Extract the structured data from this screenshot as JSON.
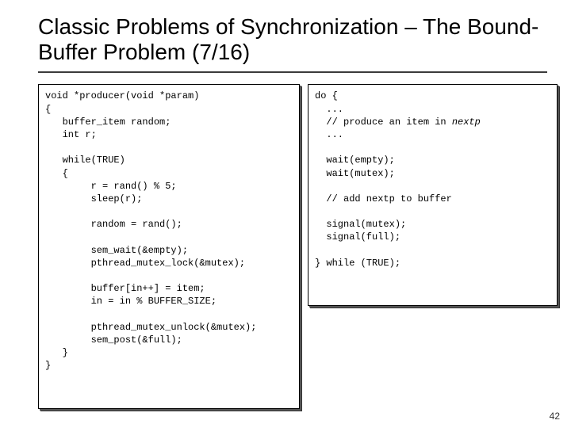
{
  "title": "Classic Problems of Synchronization – The Bound-Buffer Problem (7/16)",
  "left": {
    "l01": "void *producer(void *param)",
    "l02": "{",
    "l03": "   buffer_item random;",
    "l04": "   int r;",
    "l05": "",
    "l06": "   while(TRUE)",
    "l07": "   {",
    "l08": "        r = rand() % 5;",
    "l09": "        sleep(r);",
    "l10": "",
    "l11": "        random = rand();",
    "l12": "",
    "l13": "        sem_wait(&empty);",
    "l14": "        pthread_mutex_lock(&mutex);",
    "l15": "",
    "l16": "        buffer[in++] = item;",
    "l17": "        in = in % BUFFER_SIZE;",
    "l18": "",
    "l19": "        pthread_mutex_unlock(&mutex);",
    "l20": "        sem_post(&full);",
    "l21": "   }",
    "l22": "}"
  },
  "right": {
    "r01": "do {",
    "r02": "  ...",
    "r03a": "  // produce an item in ",
    "r03b": "nextp",
    "r04": "  ...",
    "r05": "",
    "r06": "  wait(empty);",
    "r07": "  wait(mutex);",
    "r08": "",
    "r09": "  // add nextp to buffer",
    "r10": "",
    "r11": "  signal(mutex);",
    "r12": "  signal(full);",
    "r13": "",
    "r14": "} while (TRUE);"
  },
  "pagenum": "42"
}
